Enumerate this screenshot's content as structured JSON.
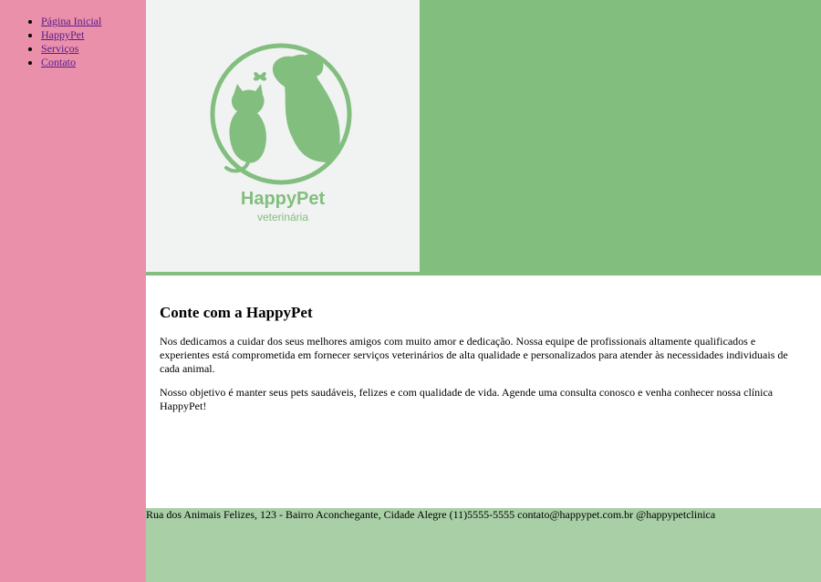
{
  "nav": {
    "items": [
      {
        "label": "Página Inicial"
      },
      {
        "label": "HappyPet"
      },
      {
        "label": "Serviços"
      },
      {
        "label": "Contato"
      }
    ]
  },
  "logo": {
    "brand": "HappyPet",
    "tagline": "veterinária"
  },
  "main": {
    "heading": "Conte com a HappyPet",
    "paragraphs": [
      "Nos dedicamos a cuidar dos seus melhores amigos com muito amor e dedicação. Nossa equipe de profissionais altamente qualificados e experientes está comprometida em fornecer serviços veterinários de alta qualidade e personalizados para atender às necessidades individuais de cada animal.",
      "Nosso objetivo é manter seus pets saudáveis, felizes e com qualidade de vida. Agende uma consulta conosco e venha conhecer nossa clínica HappyPet!"
    ]
  },
  "footer": {
    "address": "Rua dos Animais Felizes, 123 - Bairro Aconchegante, Cidade Alegre",
    "phone": "(11)5555-5555",
    "email": "contato@happypet.com.br",
    "social": "@happypetclinica"
  },
  "colors": {
    "sidebar": "#eb90ab",
    "brand_green": "#82be7e",
    "footer_green": "#a9cfa7",
    "logo_background": "#f1f3f2",
    "link": "#551a8b"
  },
  "icons": {
    "logo": "cat-and-dog-with-butterfly-logo"
  }
}
